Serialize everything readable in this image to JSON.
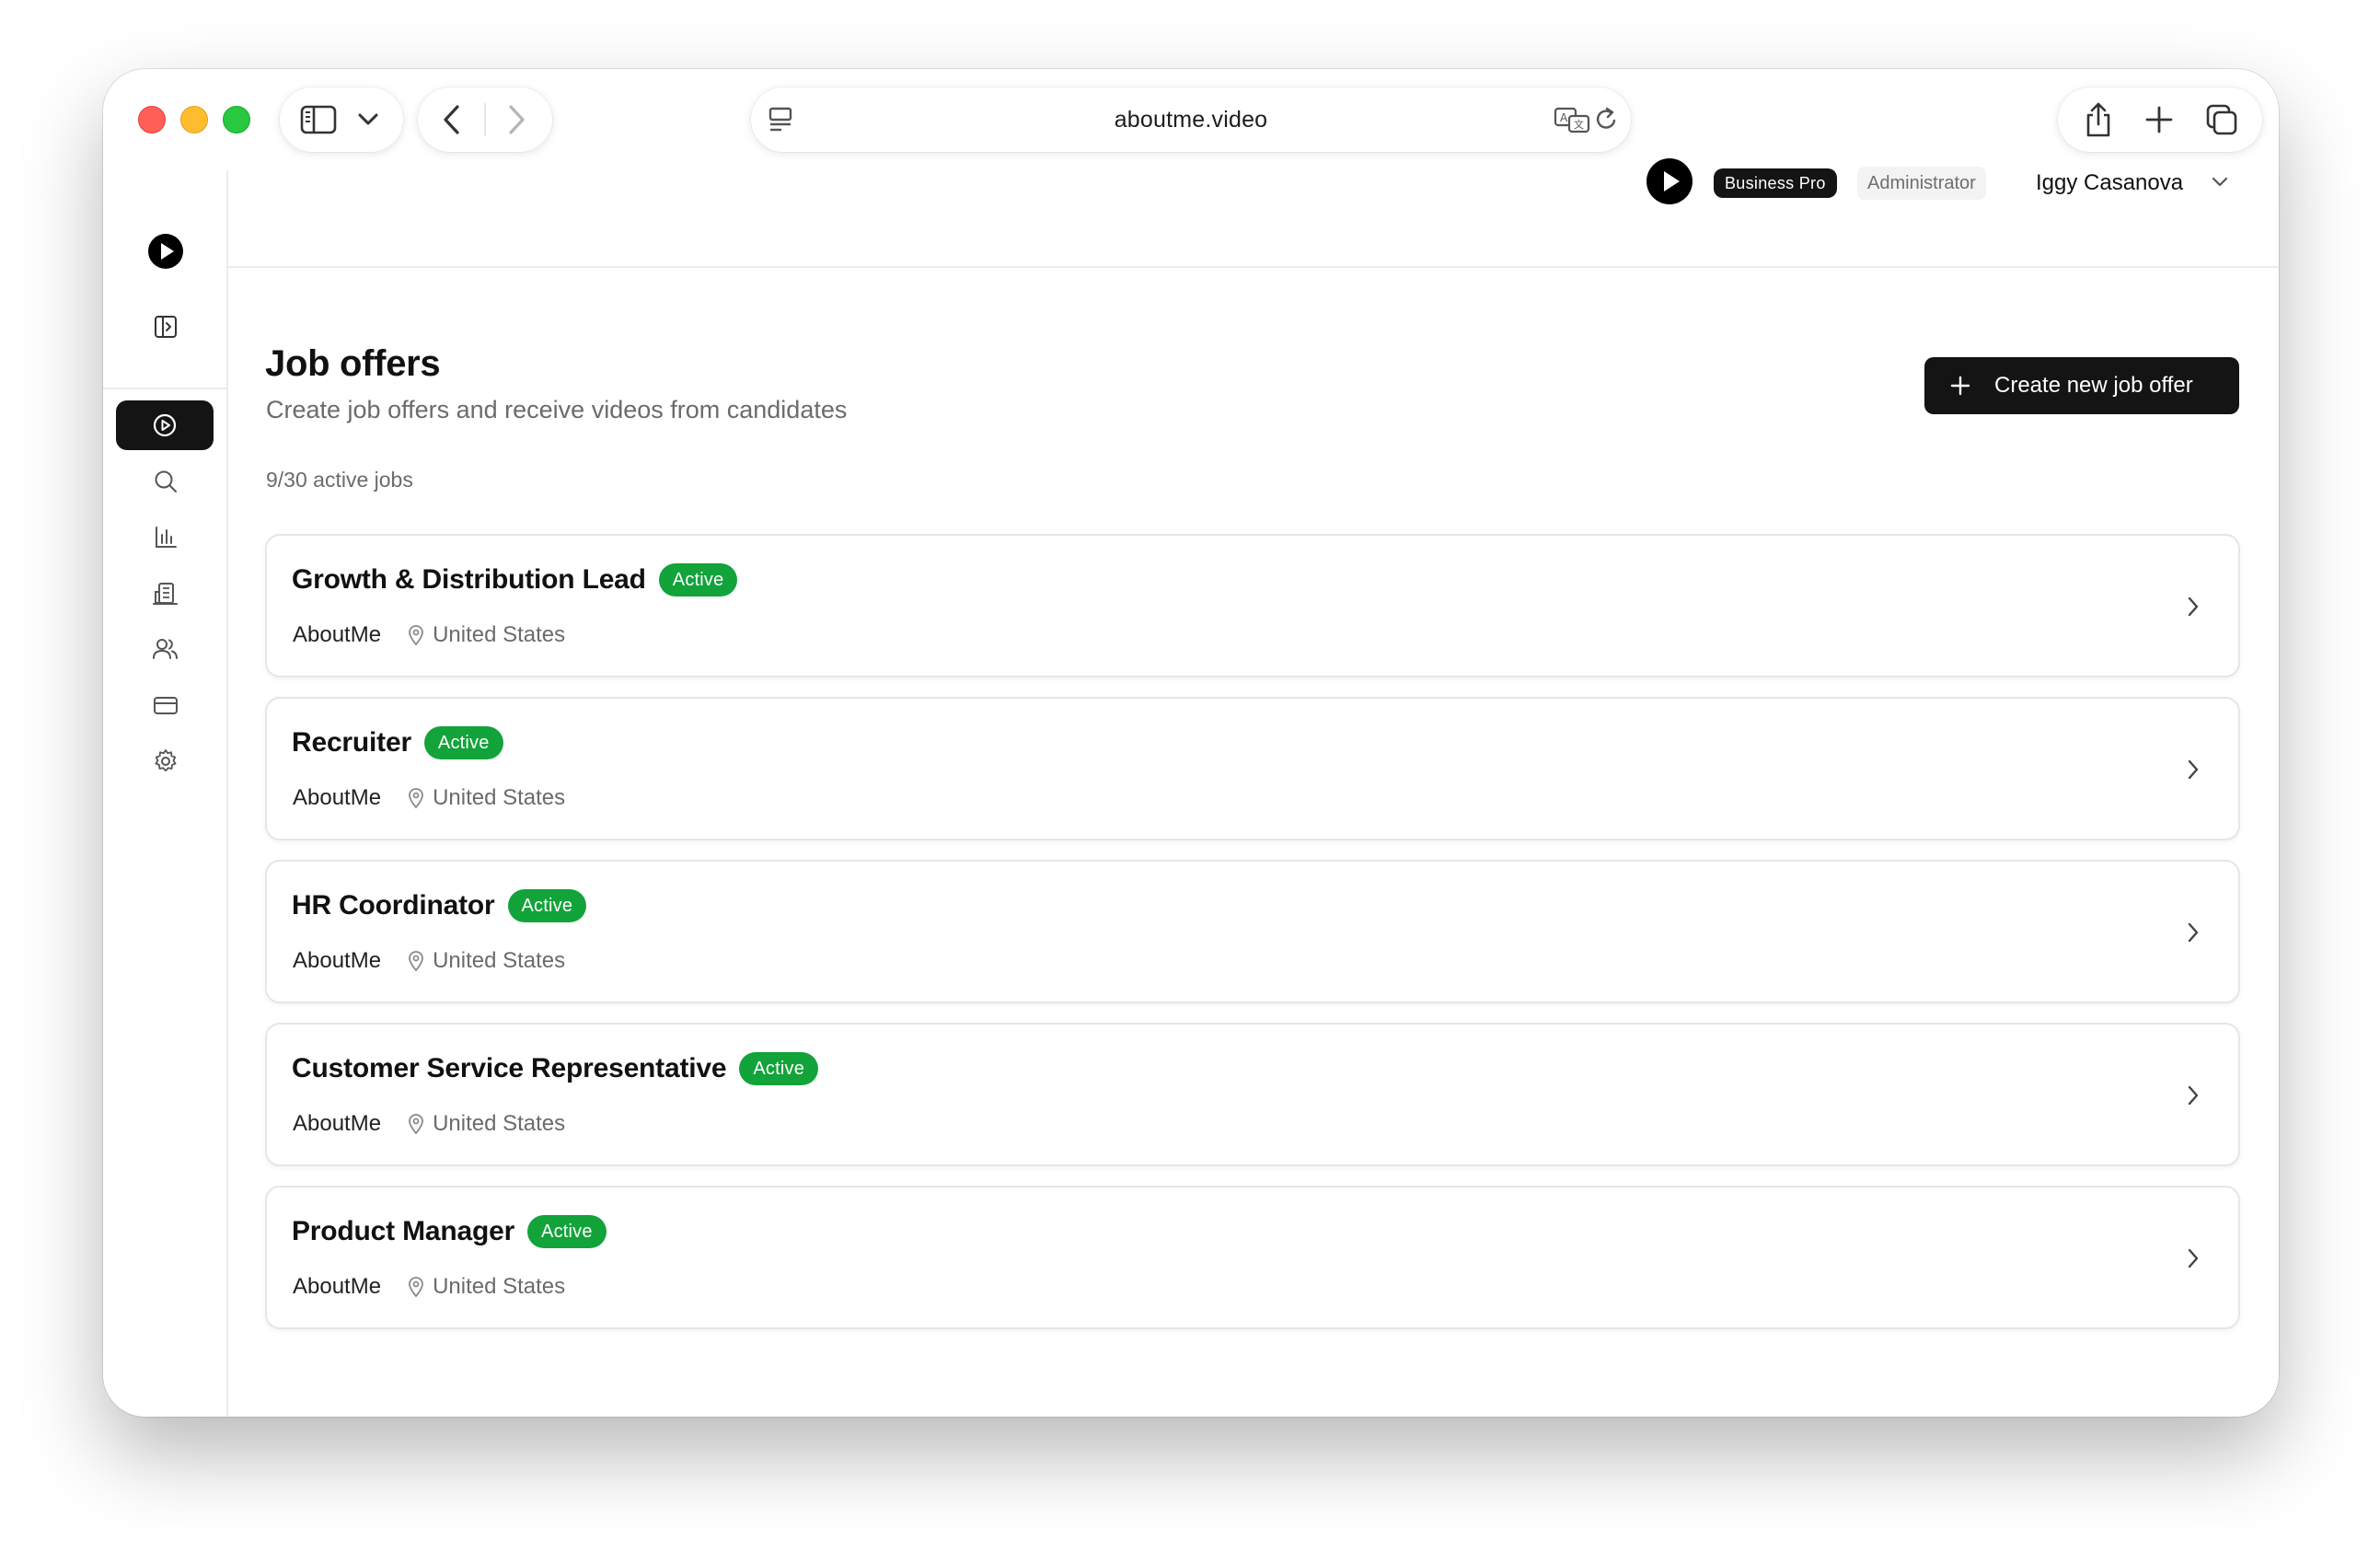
{
  "browser": {
    "url": "aboutme.video"
  },
  "header": {
    "plan_badge": "Business Pro",
    "role_badge": "Administrator",
    "user_name": "Iggy Casanova"
  },
  "sidebar": {
    "items": [
      {
        "icon": "play-circle-icon",
        "active": true
      },
      {
        "icon": "search-icon",
        "active": false
      },
      {
        "icon": "bar-chart-icon",
        "active": false
      },
      {
        "icon": "building-icon",
        "active": false
      },
      {
        "icon": "users-icon",
        "active": false
      },
      {
        "icon": "credit-card-icon",
        "active": false
      },
      {
        "icon": "settings-gear-icon",
        "active": false
      }
    ]
  },
  "main": {
    "title": "Job offers",
    "subtitle": "Create job offers and receive videos from candidates",
    "create_button": "Create new job offer",
    "active_count": "9/30 active jobs",
    "jobs": [
      {
        "title": "Growth & Distribution Lead",
        "status": "Active",
        "company": "AboutMe",
        "location": "United States"
      },
      {
        "title": "Recruiter",
        "status": "Active",
        "company": "AboutMe",
        "location": "United States"
      },
      {
        "title": "HR Coordinator",
        "status": "Active",
        "company": "AboutMe",
        "location": "United States"
      },
      {
        "title": "Customer Service Representative",
        "status": "Active",
        "company": "AboutMe",
        "location": "United States"
      },
      {
        "title": "Product Manager",
        "status": "Active",
        "company": "AboutMe",
        "location": "United States"
      }
    ]
  },
  "colors": {
    "accent_dark": "#141414",
    "status_green": "#12a33a",
    "muted_text": "#6b6b6b"
  }
}
